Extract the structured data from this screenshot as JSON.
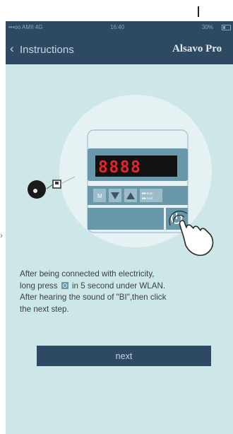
{
  "status_bar": {
    "carrier": "•••oo AMII 4G",
    "time": "16:40",
    "battery": "30%"
  },
  "nav": {
    "back_label": "Instructions",
    "brand": "Alsavo Pro"
  },
  "device": {
    "display_digits": "8888",
    "m_button_label": "M",
    "mode_labels": [
      "■■ auto",
      "■■ cool"
    ]
  },
  "instructions": {
    "line1": "After being connected with electricity,",
    "line2_before": "long press",
    "line2_after": "in 5 second under WLAN.",
    "line3": "After hearing the sound of \"BI\",then click",
    "line4": "the next step."
  },
  "buttons": {
    "next_label": "next"
  },
  "colors": {
    "header": "#2e4a63",
    "background": "#cde6e8",
    "display_red": "#e8242b",
    "panel_blue": "#6a98ab"
  },
  "icons": [
    "back-chevron-icon",
    "battery-icon",
    "power-icon",
    "hand-pointer-icon",
    "down-arrow-icon",
    "up-arrow-icon",
    "wifi-module-icon"
  ]
}
